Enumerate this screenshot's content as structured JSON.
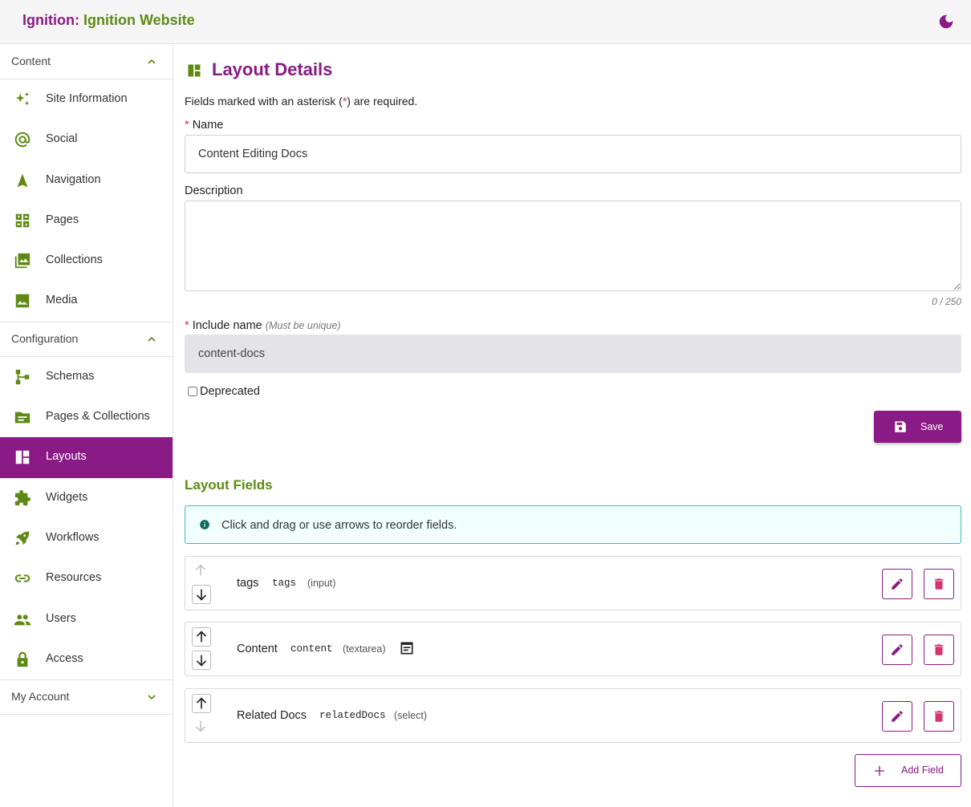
{
  "header": {
    "brand_prefix": "Ignition:",
    "brand_site": "Ignition Website",
    "theme_icon": "moon-icon"
  },
  "sidebar": {
    "sections": [
      {
        "label": "Content",
        "items": [
          {
            "label": "Site Information",
            "icon": "sparkle-icon"
          },
          {
            "label": "Social",
            "icon": "at-sign-icon"
          },
          {
            "label": "Navigation",
            "icon": "navigation-arrow-icon"
          },
          {
            "label": "Pages",
            "icon": "pages-icon"
          },
          {
            "label": "Collections",
            "icon": "image-collection-icon"
          },
          {
            "label": "Media",
            "icon": "image-icon"
          }
        ]
      },
      {
        "label": "Configuration",
        "items": [
          {
            "label": "Schemas",
            "icon": "schema-tree-icon"
          },
          {
            "label": "Pages & Collections",
            "icon": "folder-icon"
          },
          {
            "label": "Layouts",
            "icon": "layout-icon",
            "active": true
          },
          {
            "label": "Widgets",
            "icon": "puzzle-icon"
          },
          {
            "label": "Workflows",
            "icon": "rocket-icon"
          },
          {
            "label": "Resources",
            "icon": "link-icon"
          },
          {
            "label": "Users",
            "icon": "users-icon"
          },
          {
            "label": "Access",
            "icon": "lock-icon"
          }
        ]
      },
      {
        "label": "My Account",
        "items": []
      }
    ]
  },
  "main": {
    "title": "Layout Details",
    "required_note_pre": "Fields marked with an asterisk (",
    "required_note_star": "*",
    "required_note_post": ") are required.",
    "name": {
      "label": "Name",
      "value": "Content Editing Docs"
    },
    "description": {
      "label": "Description",
      "value": "",
      "counter": "0 / 250"
    },
    "include_name": {
      "label": "Include name",
      "hint": "(Must be unique)",
      "value": "content-docs"
    },
    "deprecated": {
      "label": "Deprecated",
      "checked": false
    },
    "save_label": "Save",
    "fields_title": "Layout Fields",
    "reorder_info": "Click and drag or use arrows to reorder fields.",
    "fields": [
      {
        "label": "tags",
        "key": "tags",
        "type": "(input)",
        "up_enabled": false,
        "down_enabled": true,
        "extra_icon": ""
      },
      {
        "label": "Content",
        "key": "content",
        "type": "(textarea)",
        "up_enabled": true,
        "down_enabled": true,
        "extra_icon": "rich-text-icon"
      },
      {
        "label": "Related Docs",
        "key": "relatedDocs",
        "type": "(select)",
        "up_enabled": true,
        "down_enabled": false,
        "extra_icon": ""
      }
    ],
    "add_field_label": "Add Field"
  },
  "colors": {
    "brand_purple": "#8a1a86",
    "brand_green": "#5e8a14",
    "alert_border": "#3cbfae",
    "required_star": "#d9304a"
  }
}
